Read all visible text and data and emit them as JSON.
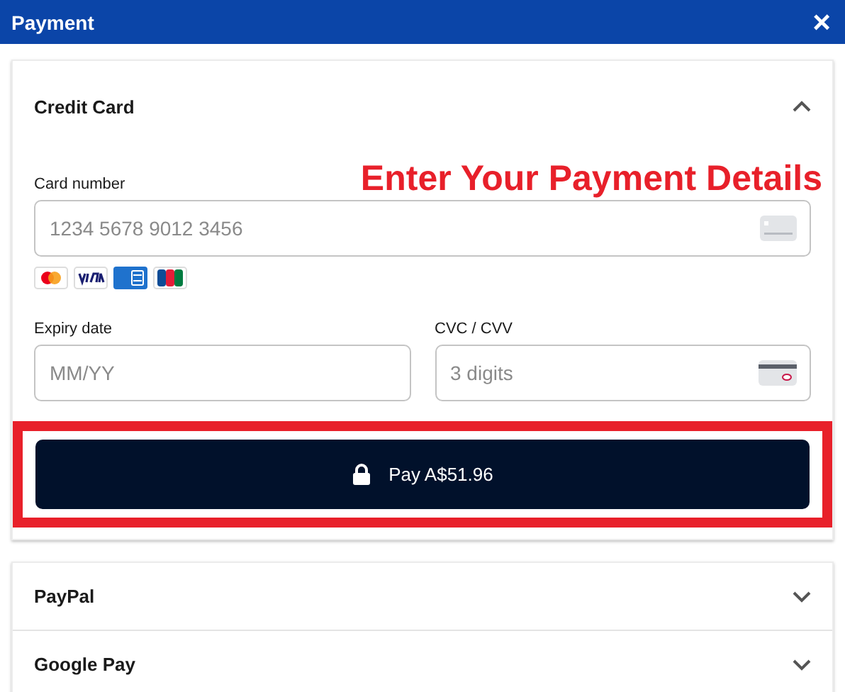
{
  "window": {
    "title": "Payment",
    "close": "×"
  },
  "annotation": "Enter Your Payment Details",
  "credit_card": {
    "title": "Credit Card",
    "expanded": true,
    "card_number": {
      "label": "Card number",
      "placeholder": "1234 5678 9012 3456"
    },
    "expiry": {
      "label": "Expiry date",
      "placeholder": "MM/YY"
    },
    "cvc": {
      "label": "CVC / CVV",
      "placeholder": "3 digits"
    },
    "pay_button": "Pay A$51.96",
    "highlighted": true
  },
  "other_methods": [
    {
      "title": "PayPal",
      "expanded": false
    },
    {
      "title": "Google Pay",
      "expanded": false
    }
  ]
}
